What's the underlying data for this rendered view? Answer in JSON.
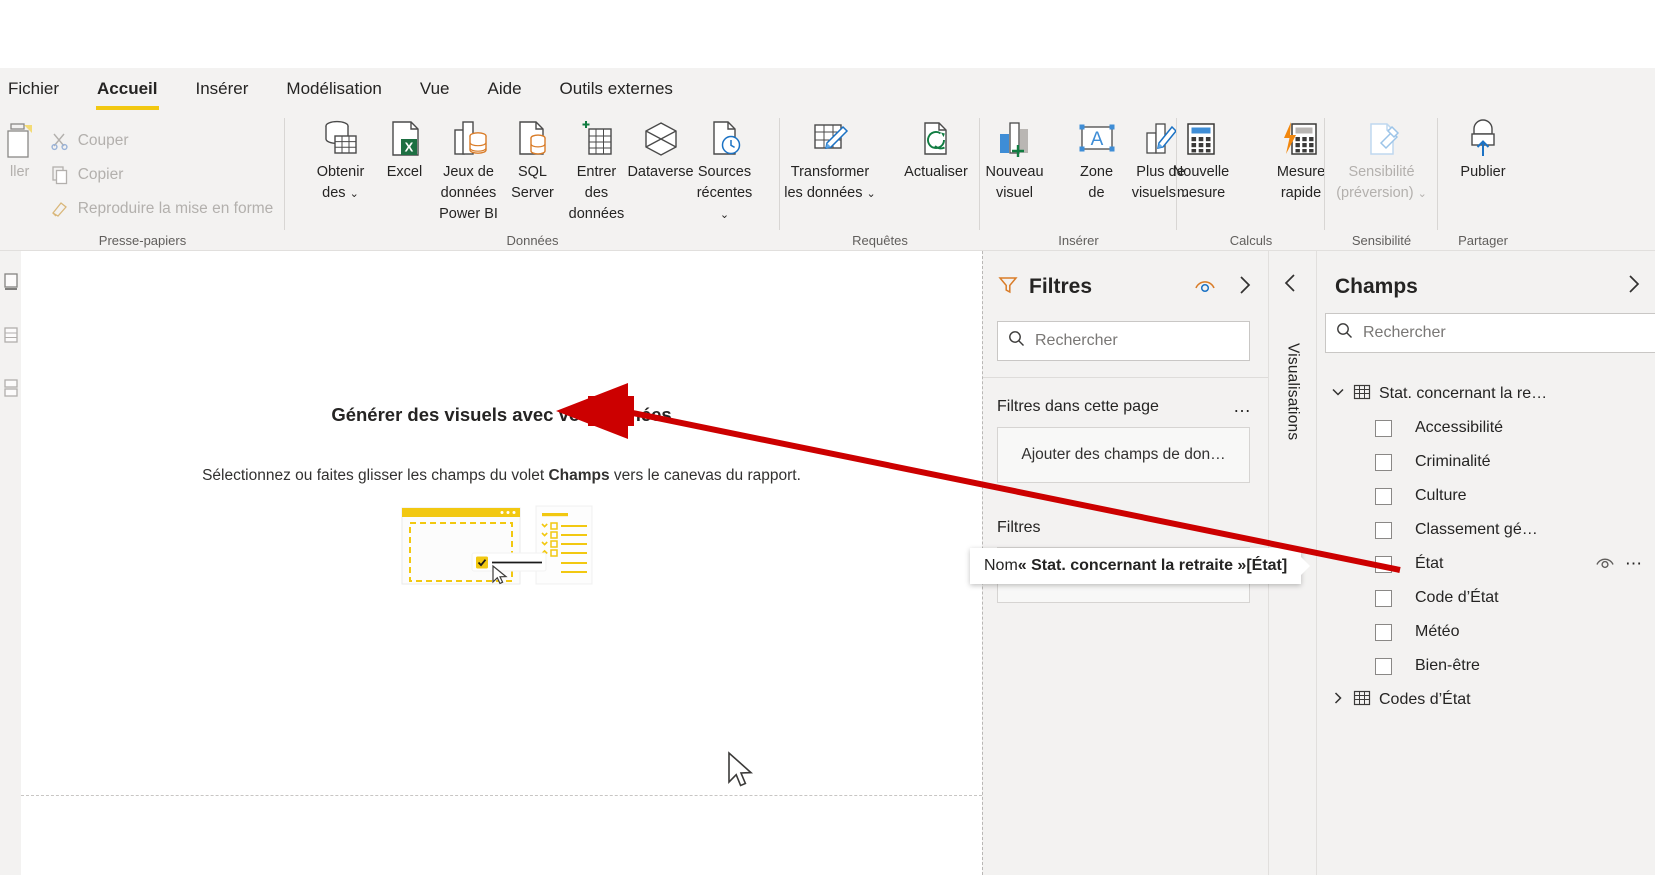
{
  "ribbon": {
    "tabs": [
      {
        "label": "Fichier",
        "active": false
      },
      {
        "label": "Accueil",
        "active": true
      },
      {
        "label": "Insérer",
        "active": false
      },
      {
        "label": "Modélisation",
        "active": false
      },
      {
        "label": "Vue",
        "active": false
      },
      {
        "label": "Aide",
        "active": false
      },
      {
        "label": "Outils externes",
        "active": false
      }
    ],
    "groups": [
      {
        "name": "Presse-papiers",
        "label": "Presse-papiers",
        "paste_label": "ller",
        "items": [
          {
            "label": "Couper",
            "icon": "scissors-icon",
            "disabled": true
          },
          {
            "label": "Copier",
            "icon": "copy-icon",
            "disabled": true
          },
          {
            "label": "Reproduire la mise en forme",
            "icon": "format-painter-icon",
            "disabled": true
          }
        ]
      },
      {
        "name": "Données",
        "label": "Données",
        "extra_label": "Power BI",
        "items": [
          {
            "label": "Obtenir des",
            "icon": "get-data-icon",
            "caret": true
          },
          {
            "label": "Excel",
            "icon": "excel-icon",
            "caret": false
          },
          {
            "label": "Jeux de données Power BI",
            "icon": "powerbi-datasets-icon",
            "caret": false
          },
          {
            "label": "SQL Server",
            "icon": "sql-server-icon",
            "caret": false
          },
          {
            "label": "Entrer des données",
            "icon": "enter-data-icon",
            "caret": false
          },
          {
            "label": "Dataverse",
            "icon": "dataverse-icon",
            "caret": false
          },
          {
            "label": "Sources récentes",
            "icon": "recent-sources-icon",
            "caret": true
          }
        ]
      },
      {
        "name": "Requêtes",
        "label": "Requêtes",
        "items": [
          {
            "label": "Transformer les données",
            "icon": "transform-data-icon",
            "caret": true
          },
          {
            "label": "Actualiser",
            "icon": "refresh-icon",
            "caret": false
          }
        ]
      },
      {
        "name": "Insérer",
        "label": "Insérer",
        "items": [
          {
            "label": "Nouveau visuel",
            "icon": "new-visual-icon",
            "caret": false
          },
          {
            "label": "Zone de",
            "icon": "text-box-icon",
            "caret": false
          },
          {
            "label": "Plus de visuels",
            "icon": "more-visuals-icon",
            "caret": true
          }
        ]
      },
      {
        "name": "Calculs",
        "label": "Calculs",
        "items": [
          {
            "label": "Nouvelle mesure",
            "icon": "new-measure-icon",
            "caret": false
          },
          {
            "label": "Mesure rapide",
            "icon": "quick-measure-icon",
            "caret": false
          }
        ]
      },
      {
        "name": "Sensibilité",
        "label": "Sensibilité",
        "items": [
          {
            "label": "Sensibilité (préversion)",
            "icon": "sensitivity-icon",
            "caret": true,
            "disabled": true
          }
        ]
      },
      {
        "name": "Partager",
        "label": "Partager",
        "items": [
          {
            "label": "Publier",
            "icon": "publish-icon",
            "caret": false
          }
        ]
      }
    ]
  },
  "left_rail": {
    "items": [
      {
        "name": "report-view",
        "icon": "report-view-icon"
      },
      {
        "name": "data-view",
        "icon": "data-view-icon"
      },
      {
        "name": "model-view",
        "icon": "model-view-icon"
      }
    ]
  },
  "canvas": {
    "empty_title": "Générer des visuels avec vos données",
    "empty_sub_before": "Sélectionnez ou faites glisser les champs du volet ",
    "empty_sub_bold": "Champs",
    "empty_sub_after": " vers le canevas du rapport."
  },
  "filters": {
    "title": "Filtres",
    "search_placeholder": "Rechercher",
    "section_page": "Filtres dans cette page",
    "section_page_more": "…",
    "dropzone_page": "Ajouter des champs de don…",
    "section_all": "Filtres",
    "dropzone_all": "Ajouter des champs de don…",
    "eye_icon": "hidden-eye-icon",
    "expand_icon": "chevron-right-icon"
  },
  "visualizations": {
    "label": "Visualisations",
    "collapse_icon": "chevron-left-icon"
  },
  "fields": {
    "title": "Champs",
    "expand_icon": "chevron-right-icon",
    "search_placeholder": "Rechercher",
    "tables": [
      {
        "name": "Stat. concernant la re…",
        "expanded": true,
        "expand_glyph": "chevron-down-icon",
        "columns": [
          {
            "label": "Accessibilité",
            "checked": false,
            "selected": false
          },
          {
            "label": "Criminalité",
            "checked": false,
            "selected": false
          },
          {
            "label": "Culture",
            "checked": false,
            "selected": false
          },
          {
            "label": "Classement gé…",
            "checked": false,
            "selected": false
          },
          {
            "label": "État",
            "checked": false,
            "selected": true,
            "eye_icon": "hidden-eye-icon",
            "more_icon": "more-ellipsis-icon"
          },
          {
            "label": "Code d’État",
            "checked": false,
            "selected": false
          },
          {
            "label": "Météo",
            "checked": false,
            "selected": false
          },
          {
            "label": "Bien-être",
            "checked": false,
            "selected": false
          }
        ]
      },
      {
        "name": "Codes d’État",
        "expanded": false,
        "expand_glyph": "chevron-right-icon",
        "columns": []
      }
    ]
  },
  "tooltip": {
    "prefix": "Nom ",
    "quoted": "« Stat. concernant la retraite »",
    "suffix": " [État]"
  },
  "annotation": {
    "color": "#CC0000",
    "shape": "arrow-pointing-left"
  },
  "colors": {
    "accent_yellow": "#F2C811",
    "ribbon_bg": "#f3f2f1",
    "canvas_bg": "#ffffff",
    "text": "#252423"
  }
}
